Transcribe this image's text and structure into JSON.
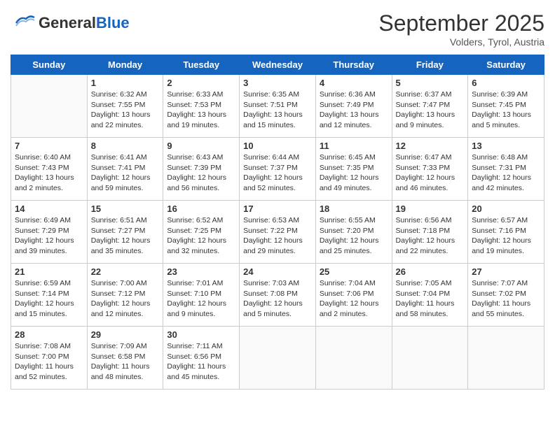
{
  "header": {
    "logo_general": "General",
    "logo_blue": "Blue",
    "month": "September 2025",
    "location": "Volders, Tyrol, Austria"
  },
  "days_of_week": [
    "Sunday",
    "Monday",
    "Tuesday",
    "Wednesday",
    "Thursday",
    "Friday",
    "Saturday"
  ],
  "weeks": [
    [
      {
        "day": "",
        "info": ""
      },
      {
        "day": "1",
        "info": "Sunrise: 6:32 AM\nSunset: 7:55 PM\nDaylight: 13 hours\nand 22 minutes."
      },
      {
        "day": "2",
        "info": "Sunrise: 6:33 AM\nSunset: 7:53 PM\nDaylight: 13 hours\nand 19 minutes."
      },
      {
        "day": "3",
        "info": "Sunrise: 6:35 AM\nSunset: 7:51 PM\nDaylight: 13 hours\nand 15 minutes."
      },
      {
        "day": "4",
        "info": "Sunrise: 6:36 AM\nSunset: 7:49 PM\nDaylight: 13 hours\nand 12 minutes."
      },
      {
        "day": "5",
        "info": "Sunrise: 6:37 AM\nSunset: 7:47 PM\nDaylight: 13 hours\nand 9 minutes."
      },
      {
        "day": "6",
        "info": "Sunrise: 6:39 AM\nSunset: 7:45 PM\nDaylight: 13 hours\nand 5 minutes."
      }
    ],
    [
      {
        "day": "7",
        "info": "Sunrise: 6:40 AM\nSunset: 7:43 PM\nDaylight: 13 hours\nand 2 minutes."
      },
      {
        "day": "8",
        "info": "Sunrise: 6:41 AM\nSunset: 7:41 PM\nDaylight: 12 hours\nand 59 minutes."
      },
      {
        "day": "9",
        "info": "Sunrise: 6:43 AM\nSunset: 7:39 PM\nDaylight: 12 hours\nand 56 minutes."
      },
      {
        "day": "10",
        "info": "Sunrise: 6:44 AM\nSunset: 7:37 PM\nDaylight: 12 hours\nand 52 minutes."
      },
      {
        "day": "11",
        "info": "Sunrise: 6:45 AM\nSunset: 7:35 PM\nDaylight: 12 hours\nand 49 minutes."
      },
      {
        "day": "12",
        "info": "Sunrise: 6:47 AM\nSunset: 7:33 PM\nDaylight: 12 hours\nand 46 minutes."
      },
      {
        "day": "13",
        "info": "Sunrise: 6:48 AM\nSunset: 7:31 PM\nDaylight: 12 hours\nand 42 minutes."
      }
    ],
    [
      {
        "day": "14",
        "info": "Sunrise: 6:49 AM\nSunset: 7:29 PM\nDaylight: 12 hours\nand 39 minutes."
      },
      {
        "day": "15",
        "info": "Sunrise: 6:51 AM\nSunset: 7:27 PM\nDaylight: 12 hours\nand 35 minutes."
      },
      {
        "day": "16",
        "info": "Sunrise: 6:52 AM\nSunset: 7:25 PM\nDaylight: 12 hours\nand 32 minutes."
      },
      {
        "day": "17",
        "info": "Sunrise: 6:53 AM\nSunset: 7:22 PM\nDaylight: 12 hours\nand 29 minutes."
      },
      {
        "day": "18",
        "info": "Sunrise: 6:55 AM\nSunset: 7:20 PM\nDaylight: 12 hours\nand 25 minutes."
      },
      {
        "day": "19",
        "info": "Sunrise: 6:56 AM\nSunset: 7:18 PM\nDaylight: 12 hours\nand 22 minutes."
      },
      {
        "day": "20",
        "info": "Sunrise: 6:57 AM\nSunset: 7:16 PM\nDaylight: 12 hours\nand 19 minutes."
      }
    ],
    [
      {
        "day": "21",
        "info": "Sunrise: 6:59 AM\nSunset: 7:14 PM\nDaylight: 12 hours\nand 15 minutes."
      },
      {
        "day": "22",
        "info": "Sunrise: 7:00 AM\nSunset: 7:12 PM\nDaylight: 12 hours\nand 12 minutes."
      },
      {
        "day": "23",
        "info": "Sunrise: 7:01 AM\nSunset: 7:10 PM\nDaylight: 12 hours\nand 9 minutes."
      },
      {
        "day": "24",
        "info": "Sunrise: 7:03 AM\nSunset: 7:08 PM\nDaylight: 12 hours\nand 5 minutes."
      },
      {
        "day": "25",
        "info": "Sunrise: 7:04 AM\nSunset: 7:06 PM\nDaylight: 12 hours\nand 2 minutes."
      },
      {
        "day": "26",
        "info": "Sunrise: 7:05 AM\nSunset: 7:04 PM\nDaylight: 11 hours\nand 58 minutes."
      },
      {
        "day": "27",
        "info": "Sunrise: 7:07 AM\nSunset: 7:02 PM\nDaylight: 11 hours\nand 55 minutes."
      }
    ],
    [
      {
        "day": "28",
        "info": "Sunrise: 7:08 AM\nSunset: 7:00 PM\nDaylight: 11 hours\nand 52 minutes."
      },
      {
        "day": "29",
        "info": "Sunrise: 7:09 AM\nSunset: 6:58 PM\nDaylight: 11 hours\nand 48 minutes."
      },
      {
        "day": "30",
        "info": "Sunrise: 7:11 AM\nSunset: 6:56 PM\nDaylight: 11 hours\nand 45 minutes."
      },
      {
        "day": "",
        "info": ""
      },
      {
        "day": "",
        "info": ""
      },
      {
        "day": "",
        "info": ""
      },
      {
        "day": "",
        "info": ""
      }
    ]
  ]
}
